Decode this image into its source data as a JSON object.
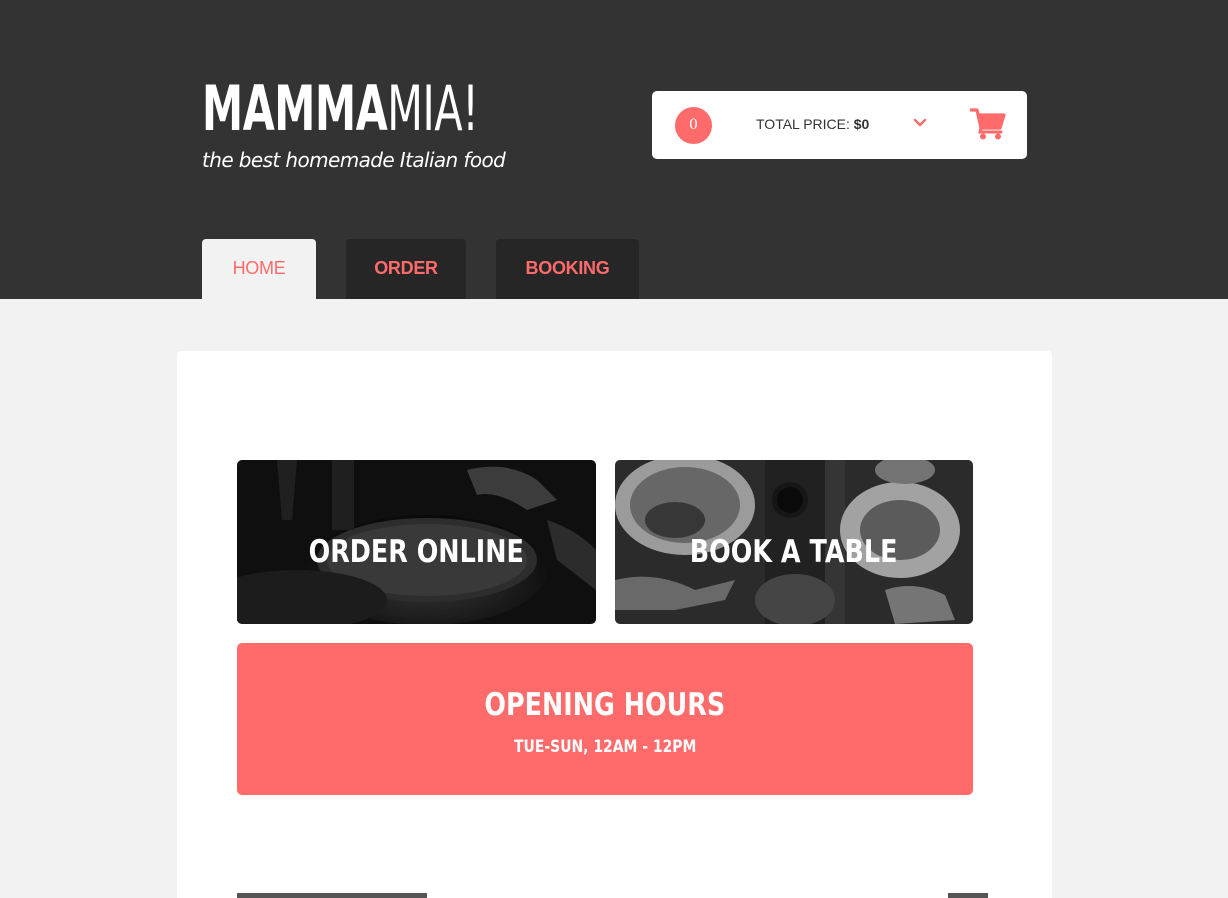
{
  "brand": {
    "name_bold": "MAMMA",
    "name_light": "MIA!",
    "tagline": "the best homemade Italian food"
  },
  "cart": {
    "count": "0",
    "total_label": "TOTAL PRICE: ",
    "total_value": "$0",
    "chevron_icon": "chevron-down-icon",
    "cart_icon": "shopping-cart-icon"
  },
  "tabs": [
    {
      "label": "HOME",
      "active": true
    },
    {
      "label": "ORDER",
      "active": false
    },
    {
      "label": "BOOKING",
      "active": false
    }
  ],
  "tiles": [
    {
      "label": "ORDER ONLINE"
    },
    {
      "label": "BOOK A TABLE"
    }
  ],
  "hours": {
    "title": "OPENING HOURS",
    "time": "TUE-SUN, 12AM - 12PM"
  },
  "colors": {
    "accent": "#ff6b6b",
    "header_bg": "#333333",
    "tab_bg": "#262626",
    "page_bg": "#f2f2f2"
  }
}
